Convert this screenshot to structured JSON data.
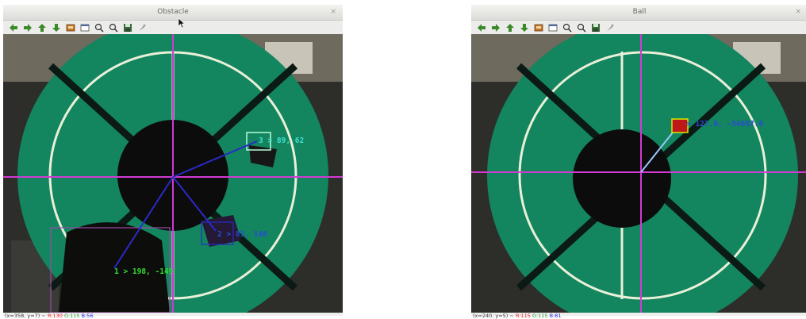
{
  "obstacle_window": {
    "title": "Obstacle",
    "close_glyph": "×",
    "toolbar_icons": [
      "arrow-left-icon",
      "arrow-right-icon",
      "arrow-up-icon",
      "arrow-down-icon",
      "save-image-icon",
      "properties-icon",
      "zoom-in-icon",
      "zoom-out-icon",
      "save-icon",
      "settings-icon"
    ],
    "labels": [
      {
        "text": "3 > 89, 62",
        "color": "#40e0d0"
      },
      {
        "text": "2 > 83, 146",
        "color": "#2a4bd7"
      },
      {
        "text": "1 > 198, -149",
        "color": "#33dd33"
      }
    ],
    "status": {
      "coords": "(x=358, y=7) ~",
      "r": "R:130",
      "g": "G:115",
      "b": "B:56"
    }
  },
  "ball_window": {
    "title": "Ball",
    "close_glyph": "×",
    "toolbar_icons": [
      "arrow-left-icon",
      "arrow-right-icon",
      "arrow-up-icon",
      "arrow-down-icon",
      "save-image-icon",
      "properties-icon",
      "zoom-in-icon",
      "zoom-out-icon",
      "save-icon",
      "settings-icon"
    ],
    "labels": [
      {
        "text": "> 127.0, -54687.6",
        "color": "#2a4bd7"
      }
    ],
    "status": {
      "coords": "(x=240, y=5) ~",
      "r": "R:115",
      "g": "G:115",
      "b": "B:81"
    }
  },
  "colors": {
    "field": "#13855f",
    "crosshair": "#d23ad2",
    "robot_line": "#2a2ac8",
    "ball_line": "#9ac8ff",
    "ball_box": "#d4e800"
  }
}
